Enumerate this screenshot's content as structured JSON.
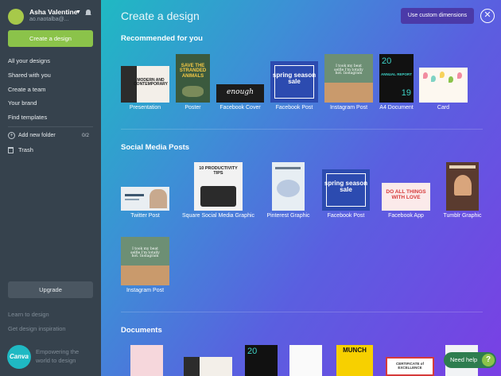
{
  "sidebar": {
    "user_name": "Asha Valentine",
    "user_email": "ao.naotalba@...",
    "create_label": "Create a design",
    "nav": [
      "All your designs",
      "Shared with you",
      "Create a team",
      "Your brand",
      "Find templates"
    ],
    "add_folder_label": "Add new folder",
    "folder_count": "0/2",
    "trash_label": "Trash",
    "upgrade_label": "Upgrade",
    "learn_label": "Learn to design",
    "inspiration_label": "Get design inspiration",
    "logo_text": "Canva",
    "tagline": "Empowering the world to design"
  },
  "main": {
    "title": "Create a design",
    "custom_label": "Use custom dimensions",
    "close_icon": "close-icon",
    "sections": [
      {
        "heading": "Recommended for you",
        "items": [
          "Presentation",
          "Poster",
          "Facebook Cover",
          "Facebook Post",
          "Instagram Post",
          "A4 Document",
          "Card"
        ]
      },
      {
        "heading": "Social Media Posts",
        "items": [
          "Twitter Post",
          "Square Social Media Graphic",
          "Pinterest Graphic",
          "Facebook Post",
          "Facebook App",
          "Tumblr Graphic",
          "Instagram Post"
        ]
      },
      {
        "heading": "Documents",
        "items": []
      }
    ],
    "thumb_text": {
      "presentation": "MODERN AND CONTEMPORARY",
      "poster": "SAVE THE STRANDED ANIMALS",
      "fbcover": "enough",
      "fbpost": "spring season sale",
      "insta_quote": "I took my beat selfie I'm totally hot. Instagram",
      "a4_top": "20",
      "a4_mid": "ANNUAL REPORT",
      "a4_bot": "19",
      "productivity": "10 PRODUCTIVITY TIPS",
      "fbapp": "DO ALL THINGS WITH LOVE",
      "munch": "MUNCH",
      "certificate": "CERTIFICATE of EXCELLENCE"
    },
    "help_label": "Need help",
    "help_glyph": "?"
  }
}
